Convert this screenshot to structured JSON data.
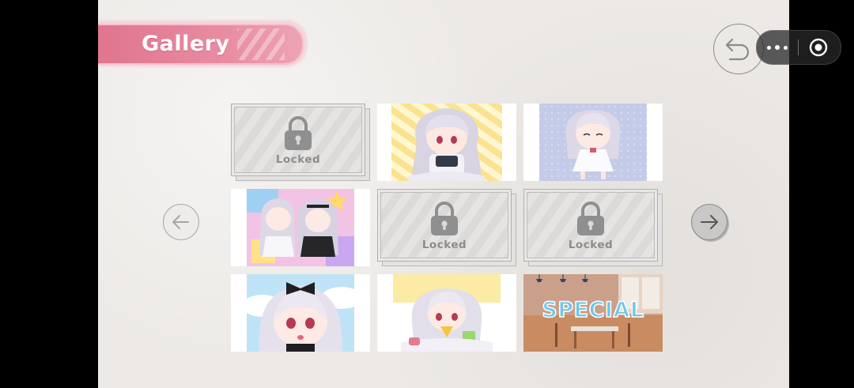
{
  "header": {
    "title": "Gallery"
  },
  "controls": {
    "back_icon": "back-arrow-icon",
    "prev_icon": "arrow-left-icon",
    "next_icon": "arrow-right-icon",
    "capsule_more_icon": "more-dots-icon",
    "capsule_close_icon": "target-circle-icon"
  },
  "gallery": {
    "locked_label": "Locked",
    "items": [
      {
        "id": 1,
        "state": "locked"
      },
      {
        "id": 2,
        "state": "unlocked",
        "art": "chibi girl holding game console, yellow striped background"
      },
      {
        "id": 3,
        "state": "unlocked",
        "art": "chibi girl in white dress, blue dotted background"
      },
      {
        "id": 4,
        "state": "unlocked",
        "art": "two chibi girls playing on a colorful floor"
      },
      {
        "id": 5,
        "state": "locked"
      },
      {
        "id": 6,
        "state": "locked"
      },
      {
        "id": 7,
        "state": "unlocked",
        "art": "chibi girl with black bow, sky background"
      },
      {
        "id": 8,
        "state": "unlocked",
        "art": "chibi girl lying down with snacks"
      },
      {
        "id": 9,
        "state": "unlocked",
        "art": "room interior",
        "label": "SPECIAL"
      }
    ]
  }
}
